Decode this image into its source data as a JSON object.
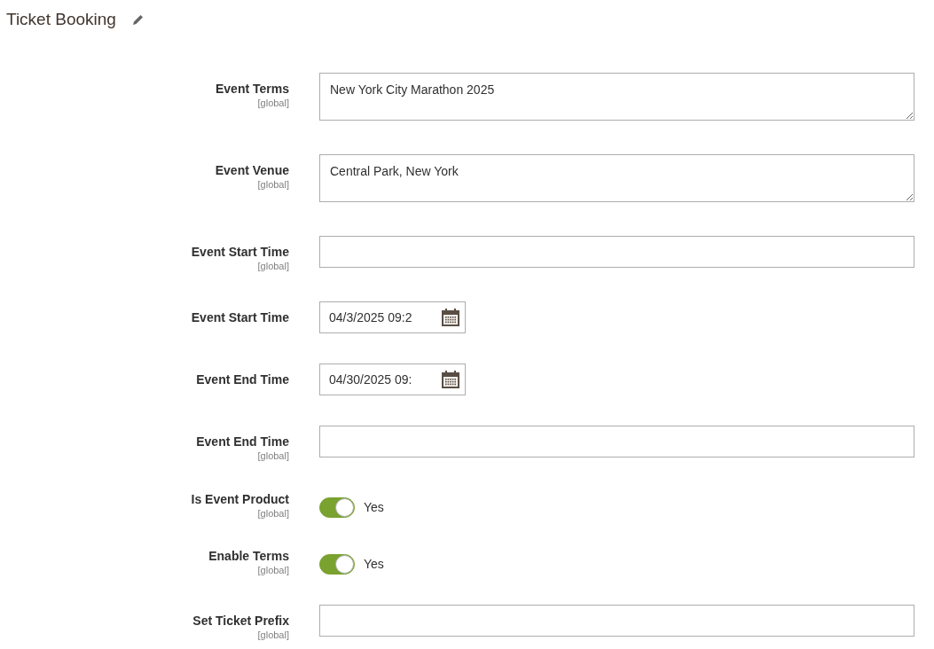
{
  "section": {
    "title": "Ticket Booking"
  },
  "fields": [
    {
      "kind": "textarea",
      "label": "Event Terms",
      "scope": "[global]",
      "value": "New York City Marathon 2025"
    },
    {
      "kind": "textarea",
      "label": "Event Venue",
      "scope": "[global]",
      "value": "Central Park, New York"
    },
    {
      "kind": "text",
      "label": "Event Start Time",
      "scope": "[global]"
    },
    {
      "kind": "date",
      "label": "Event Start Time",
      "value": "04/3/2025 09:2"
    },
    {
      "kind": "date",
      "label": "Event End Time",
      "value": "04/30/2025 09:"
    },
    {
      "kind": "text",
      "label": "Event End Time",
      "scope": "[global]"
    },
    {
      "kind": "toggle",
      "label": "Is Event Product",
      "scope": "[global]",
      "checked": true,
      "state_label": "Yes"
    },
    {
      "kind": "toggle",
      "label": "Enable Terms",
      "scope": "[global]",
      "checked": true,
      "state_label": "Yes"
    },
    {
      "kind": "text",
      "label": "Set Ticket Prefix",
      "scope": "[global]"
    }
  ]
}
